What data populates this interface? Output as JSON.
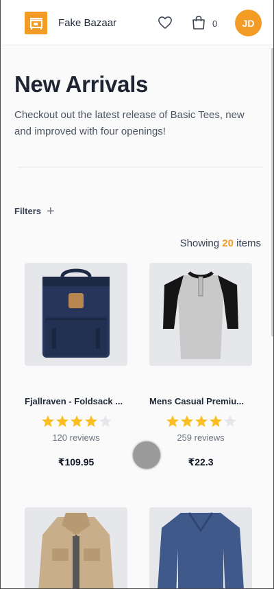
{
  "header": {
    "brand": "Fake Bazaar",
    "cart_count": "0",
    "avatar_initials": "JD",
    "accent": "#f39c25"
  },
  "hero": {
    "title": "New Arrivals",
    "subtitle": "Checkout out the latest release of Basic Tees, new and improved with four openings!"
  },
  "filters": {
    "label": "Filters",
    "plus": "+"
  },
  "showing": {
    "prefix": "Showing",
    "count": "20",
    "suffix": "items"
  },
  "products": [
    {
      "name": "Fjallraven - Foldsack ...",
      "rating": 4,
      "reviews": "120 reviews",
      "price": "₹109.95",
      "image": "backpack-image"
    },
    {
      "name": "Mens Casual Premiu...",
      "rating": 4,
      "reviews": "259 reviews",
      "price": "₹22.3",
      "image": "raglan-shirt-image"
    },
    {
      "name": "",
      "rating": 0,
      "reviews": "",
      "price": "",
      "image": "jacket-image"
    },
    {
      "name": "",
      "rating": 0,
      "reviews": "",
      "price": "",
      "image": "long-sleeve-shirt-image"
    }
  ]
}
